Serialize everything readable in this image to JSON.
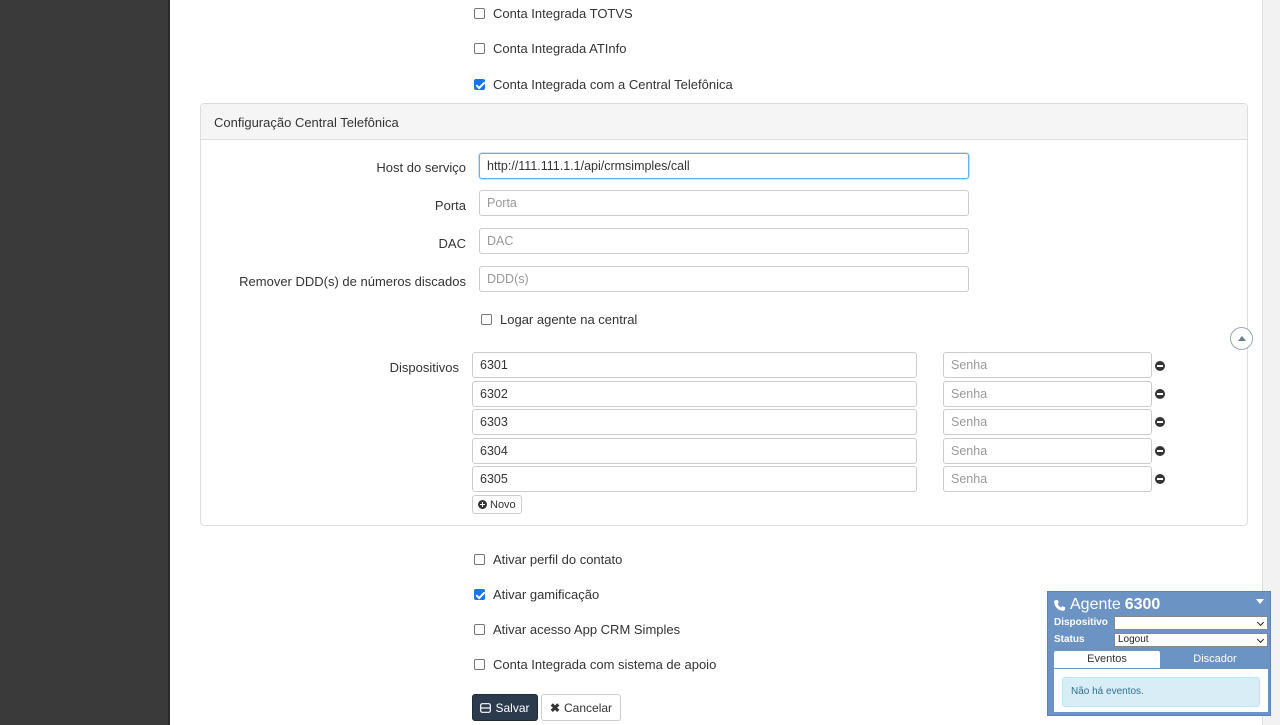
{
  "integrations": {
    "totvs": {
      "label": "Conta Integrada TOTVS",
      "checked": false
    },
    "atinfo": {
      "label": "Conta Integrada ATInfo",
      "checked": false
    },
    "central": {
      "label": "Conta Integrada com a Central Telefônica",
      "checked": true
    }
  },
  "panel": {
    "title": "Configuração Central Telefônica",
    "host": {
      "label": "Host do serviço",
      "value": "http://111.111.1.1/api/crmsimples/call"
    },
    "porta": {
      "label": "Porta",
      "placeholder": "Porta"
    },
    "dac": {
      "label": "DAC",
      "placeholder": "DAC"
    },
    "ddd": {
      "label": "Remover DDD(s) de números discados",
      "placeholder": "DDD(s)"
    },
    "logar": {
      "label": "Logar agente na central",
      "checked": false
    },
    "dispositivos": {
      "label": "Dispositivos",
      "senha_placeholder": "Senha",
      "items": [
        "6301",
        "6302",
        "6303",
        "6304",
        "6305"
      ]
    },
    "novo_label": "Novo"
  },
  "options": {
    "perfil": {
      "label": "Ativar perfil do contato",
      "checked": false
    },
    "gamificacao": {
      "label": "Ativar gamificação",
      "checked": true
    },
    "app": {
      "label": "Ativar acesso App CRM Simples",
      "checked": false
    },
    "apoio": {
      "label": "Conta Integrada com sistema de apoio",
      "checked": false
    }
  },
  "actions": {
    "save_label": "Salvar",
    "cancel_label": "Cancelar"
  },
  "agent": {
    "title_prefix": "Agente",
    "number": "6300",
    "dispositivo_label": "Dispositivo",
    "dispositivo_value": "",
    "status_label": "Status",
    "status_value": "Logout",
    "tabs": [
      "Eventos",
      "Discador"
    ],
    "empty_events": "Não há eventos."
  },
  "colors": {
    "primary": "#2b3a4c",
    "agent_bg": "#6b93c4",
    "checkbox": "#1a73e8"
  }
}
